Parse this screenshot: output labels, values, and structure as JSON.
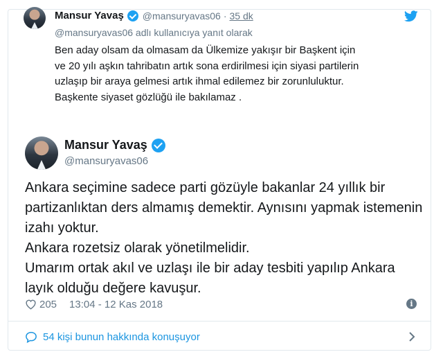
{
  "parent_tweet": {
    "name": "Mansur Yavaş",
    "handle": "@mansuryavas06",
    "separator": "·",
    "time": "35 dk",
    "reply_to": "@mansuryavas06 adlı kullanıcıya yanıt olarak",
    "text_lines": [
      "Ben aday olsam da olmasam da Ülkemize yakışır bir Başkent için",
      "ve 20 yılı aşkın tahribatın artık sona erdirilmesi için siyasi partilerin",
      "uzlaşıp bir araya gelmesi artık ihmal edilemez bir zorunluluktur.",
      "Başkente siyaset gözlüğü ile bakılamaz ."
    ]
  },
  "main_tweet": {
    "name": "Mansur Yavaş",
    "handle": "@mansuryavas06",
    "text_lines": [
      "Ankara seçimine sadece parti gözüyle bakanlar 24 yıllık bir",
      "partizanlıktan ders almamış demektir. Aynısını yapmak istemenin",
      "izahı yoktur.",
      "Ankara rozetsiz olarak yönetilmelidir.",
      "Umarım ortak akıl ve uzlaşı ile bir aday tesbiti yapılıp Ankara",
      "layık olduğu değere kavuşur."
    ],
    "likes": "205",
    "timestamp": "13:04 - 12 Kas 2018"
  },
  "footer": {
    "conversation_label": "54 kişi bunun hakkında konuşuyor"
  },
  "icons": {
    "brand": "twitter-bird-icon",
    "verified": "verified-badge-icon",
    "like": "heart-icon",
    "info": "info-icon",
    "conversation": "speech-bubble-icon",
    "chevron": "chevron-right-icon"
  },
  "colors": {
    "twitter_blue": "#1da1f2",
    "link_blue": "#1b95e0",
    "muted_text": "#657786",
    "border": "#e1e8ed"
  }
}
